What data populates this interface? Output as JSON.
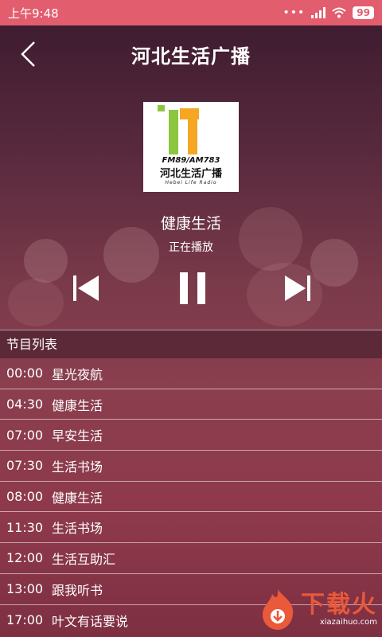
{
  "status_bar": {
    "time": "上午9:48",
    "dots": "•••",
    "battery": "99"
  },
  "header": {
    "title": "河北生活广播"
  },
  "station_logo": {
    "frequency": "FM89/AM783",
    "name": "河北生活广播",
    "english": "Hebei Life Radio"
  },
  "now_playing": {
    "program": "健康生活",
    "status": "正在播放"
  },
  "program_list": {
    "title": "节目列表",
    "items": [
      {
        "time": "00:00",
        "name": "星光夜航"
      },
      {
        "time": "04:30",
        "name": "健康生活"
      },
      {
        "time": "07:00",
        "name": "早安生活"
      },
      {
        "time": "07:30",
        "name": "生活书场"
      },
      {
        "time": "08:00",
        "name": "健康生活"
      },
      {
        "time": "11:30",
        "name": "生活书场"
      },
      {
        "time": "12:00",
        "name": "生活互助汇"
      },
      {
        "time": "13:00",
        "name": "跟我听书"
      },
      {
        "time": "17:00",
        "name": "叶文有话要说"
      }
    ]
  },
  "watermark": {
    "text": "下载火",
    "url": "xiazaihuo.com"
  },
  "colors": {
    "status_bar": "#e25d6d",
    "logo_green": "#8cc63f",
    "logo_orange": "#f5a623"
  }
}
